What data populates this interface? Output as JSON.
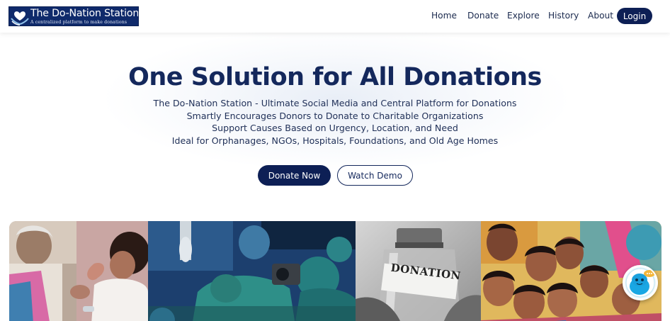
{
  "header": {
    "logo_title": "The Do-Nation Station",
    "logo_tagline": "A centralized platform to make donations",
    "nav": {
      "home": "Home",
      "donate": "Donate",
      "explore": "Explore",
      "history": "History",
      "about": "About"
    },
    "login_label": "Login"
  },
  "hero": {
    "title": "One Solution for All Donations",
    "lines": [
      "The Do-Nation Station - Ultimate Social Media and Central Platform for Donations",
      "Smartly Encourages Donors to Donate to Charitable Organizations",
      "Support Causes Based on Urgency, Location, and Need",
      "Ideal for Orphanages, NGOs, Hospitals, Foundations, and Old Age Homes"
    ],
    "donate_now_label": "Donate Now",
    "watch_demo_label": "Watch Demo"
  },
  "gallery": {
    "jar_label": "DONATION"
  },
  "colors": {
    "primary_navy": "#0d1f55",
    "title_navy": "#14285c",
    "logo_bg": "#0f2a6b"
  },
  "icons": {
    "logo": "hands-heart-icon",
    "chatbot": "chatbot-avatar-icon"
  }
}
